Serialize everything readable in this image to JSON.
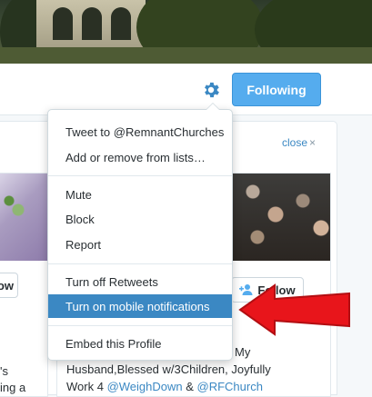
{
  "header": {
    "following_label": "Following"
  },
  "icons": {
    "gear": "gear-icon",
    "close": "close-icon",
    "follow_person": "add-person-icon"
  },
  "suggestions": {
    "close_label": "close",
    "close_glyph": "×",
    "left_card": {
      "follow_label": "ow",
      "text_line1": "'s",
      "text_line2": "ing a"
    },
    "right_card": {
      "follow_label": "Follow",
      "bio_line1": "My",
      "bio_line2": "Husband,Blessed w/3Children, Joyfully",
      "bio_line3_pre": "Work 4 ",
      "bio_mention1": "@WeighDown",
      "bio_amp": " & ",
      "bio_mention2": "@RFChurch"
    }
  },
  "menu": {
    "items": [
      {
        "label": "Tweet to @RemnantChurches"
      },
      {
        "label": "Add or remove from lists…"
      },
      {
        "label": "Mute"
      },
      {
        "label": "Block"
      },
      {
        "label": "Report"
      },
      {
        "label": "Turn off Retweets"
      },
      {
        "label": "Turn on mobile notifications",
        "highlighted": true
      },
      {
        "label": "Embed this Profile"
      }
    ]
  },
  "colors": {
    "accent": "#55acee",
    "highlight": "#3b88c3",
    "annotation_arrow": "#e8151b"
  }
}
